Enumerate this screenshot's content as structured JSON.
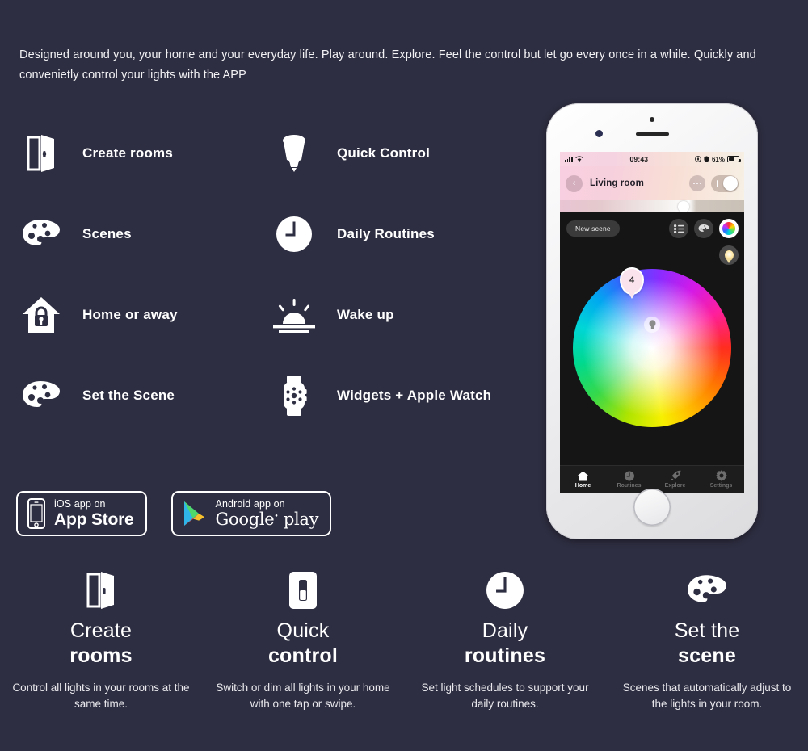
{
  "theme": {
    "background": "#2e2e42",
    "text": "#ffffff",
    "accent": "#f8cfe0"
  },
  "intro": {
    "paragraph": "Designed around you, your home and your everyday life. Play around. Explore. Feel the control but let go every once in a while. Quickly and convenietly control your lights with the  APP"
  },
  "features": [
    {
      "label": "Create rooms",
      "icon": "open-door-icon"
    },
    {
      "label": "Quick Control",
      "icon": "light-bulb-icon"
    },
    {
      "label": "Scenes",
      "icon": "palette-icon"
    },
    {
      "label": "Daily Routines",
      "icon": "clock-icon"
    },
    {
      "label": "Home or away",
      "icon": "house-lock-icon"
    },
    {
      "label": "Wake up",
      "icon": "sunrise-icon"
    },
    {
      "label": "Set the Scene",
      "icon": "palette-icon"
    },
    {
      "label": "Widgets + Apple Watch",
      "icon": "apple-watch-icon"
    }
  ],
  "stores": [
    {
      "top": "iOS app on",
      "name": "App Store",
      "icon": "iphone-icon"
    },
    {
      "top": "Android app on",
      "name": "Google",
      "name2": "play",
      "icon": "google-play-icon"
    }
  ],
  "phone": {
    "statusbar": {
      "time": "09:43",
      "battery": "61%",
      "signal_icon": "signal-bars-icon",
      "wifi_icon": "wifi-icon",
      "location_icon": "location-icon",
      "alarm_icon": "shield-icon"
    },
    "header": {
      "back_icon": "chevron-left-icon",
      "title": "Living room",
      "more_icon": "ellipsis-icon",
      "power_toggle": "on"
    },
    "brightness": {
      "value": "64"
    },
    "toolbar": {
      "new_scene": "New scene",
      "list_icon": "list-icon",
      "palette_icon": "palette-icon",
      "color_wheel_icon": "color-wheel-icon",
      "pin_icon": "light-pin-icon"
    },
    "color_wheel": {
      "pin_label": "4",
      "bulb_icon": "bulb-icon"
    },
    "tabs": [
      {
        "label": "Home",
        "icon": "home-icon",
        "active": true
      },
      {
        "label": "Routines",
        "icon": "clock-icon",
        "active": false
      },
      {
        "label": "Explore",
        "icon": "rocket-icon",
        "active": false
      },
      {
        "label": "Settings",
        "icon": "gear-icon",
        "active": false
      }
    ]
  },
  "cards": [
    {
      "title1": "Create",
      "title2": "rooms",
      "desc": "Control all lights in your rooms at the same time.",
      "icon": "open-door-icon"
    },
    {
      "title1": "Quick",
      "title2": "control",
      "desc": "Switch or dim all lights in your home with one tap or swipe.",
      "icon": "light-switch-icon"
    },
    {
      "title1": "Daily",
      "title2": "routines",
      "desc": "Set light schedules to support your daily routines.",
      "icon": "clock-icon"
    },
    {
      "title1": "Set the",
      "title2": "scene",
      "desc": "Scenes that automatically adjust to the lights in your room.",
      "icon": "palette-icon"
    }
  ]
}
